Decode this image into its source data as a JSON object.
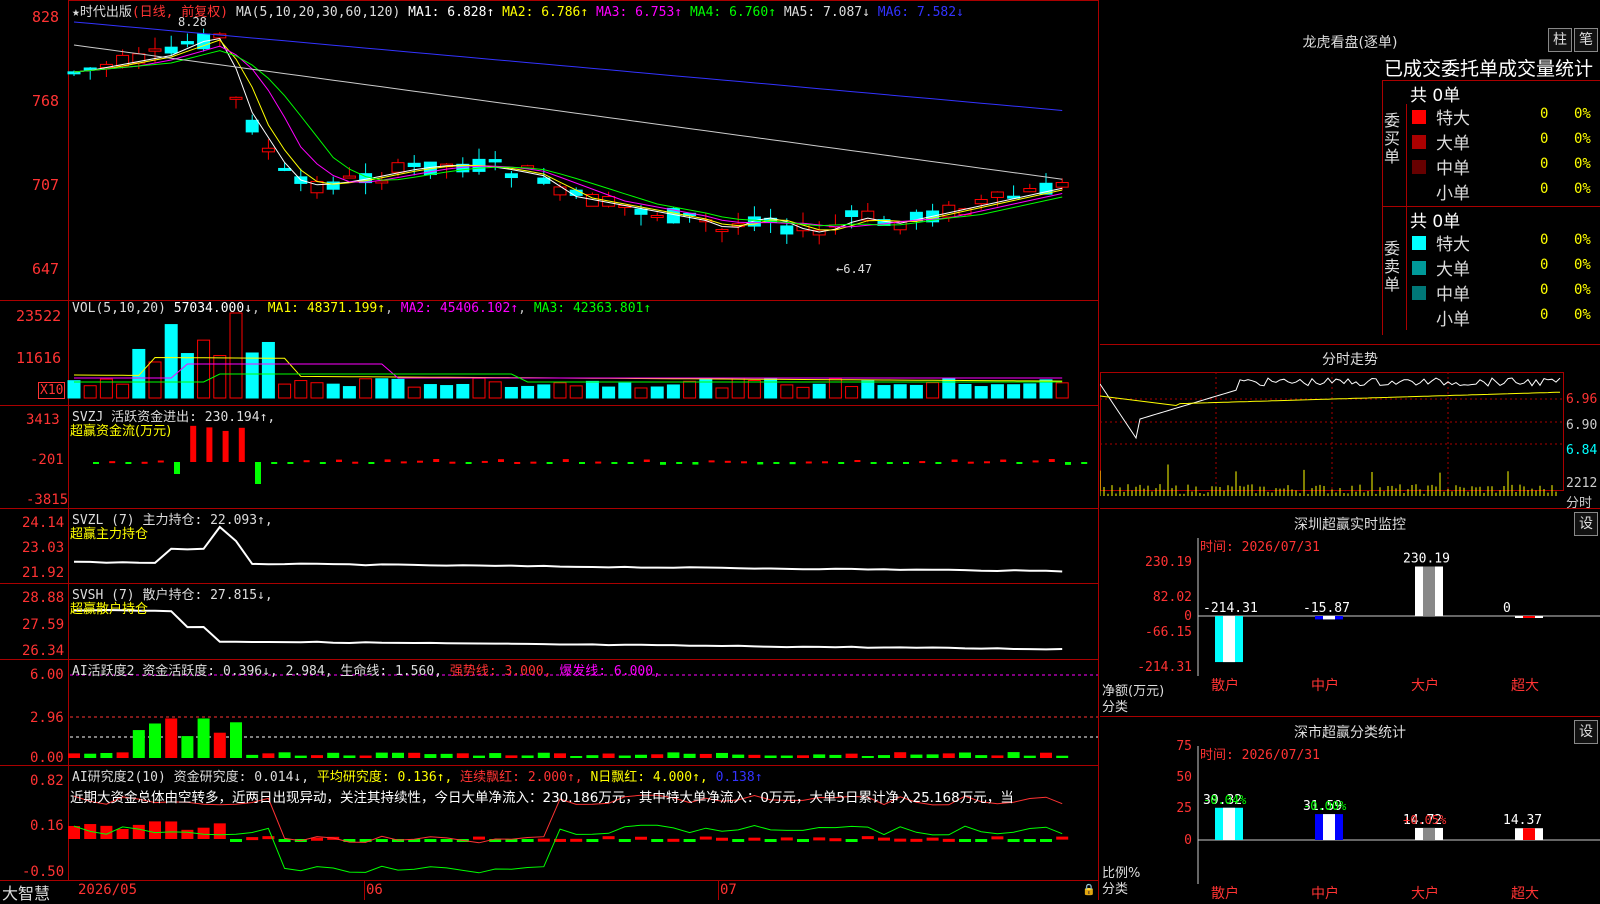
{
  "main": {
    "stock_title": "★时代出版",
    "period": "(日线, 前复权)",
    "ma_header": "MA(5,10,20,30,60,120)",
    "ma": [
      {
        "label": "MA1:",
        "value": "6.828",
        "arrow": "↑",
        "color": "#ffffff"
      },
      {
        "label": "MA2:",
        "value": "6.786",
        "arrow": "↑",
        "color": "#ffff00"
      },
      {
        "label": "MA3:",
        "value": "6.753",
        "arrow": "↑",
        "color": "#ff00ff"
      },
      {
        "label": "MA4:",
        "value": "6.760",
        "arrow": "↑",
        "color": "#00ff00"
      },
      {
        "label": "MA5:",
        "value": "7.087",
        "arrow": "↓",
        "color": "#dddddd"
      },
      {
        "label": "MA6:",
        "value": "7.582",
        "arrow": "↓",
        "color": "#3333ff"
      }
    ],
    "price_ticks": [
      "828",
      "768",
      "707",
      "647"
    ],
    "high_mark": "8.28",
    "low_mark": "←6.47",
    "x10_label": "X10"
  },
  "volume": {
    "header": "VOL(5,10,20)",
    "value": "57034.000↓",
    "ma1": "MA1: 48371.199↑",
    "ma2": "MA2: 45406.102↑",
    "ma3": "MA3: 42363.801↑",
    "ticks": [
      "23522",
      "11616"
    ]
  },
  "svzj": {
    "header": "SVZJ  活跃资金进出: 230.194↑,",
    "sub": "超赢资金流(万元)",
    "ticks": [
      "3413",
      "-201",
      "-3815"
    ]
  },
  "svzl": {
    "header": "SVZL (7) 主力持仓: 22.093↑,",
    "sub": "超赢主力持仓",
    "ticks": [
      "24.14",
      "23.03",
      "21.92"
    ]
  },
  "svsh": {
    "header": "SVSH (7) 散户持仓: 27.815↓,",
    "sub": "超赢散户持仓",
    "ticks": [
      "28.88",
      "27.59",
      "26.34"
    ]
  },
  "ai_active": {
    "header": "AI活跃度2 资金活跃度: 0.396↓, 2.984, 生命线: 1.560,",
    "strong": "强势线: 3.000,",
    "burst": "爆发线: 6.000,",
    "ticks": [
      "6.00",
      "2.96",
      "0.00"
    ]
  },
  "ai_research": {
    "header": "AI研究度2(10) 资金研究度: 0.014↓,",
    "avg": "平均研究度: 0.136↑,",
    "cont": "连续飘红: 2.000↑,",
    "nday": "N日飘红: 4.000↑,",
    "last": "0.138↑",
    "commentary": "近期大资金总体由空转多，近两日出现异动，关注其持续性，今日大单净流入：230.186万元，其中特大单净流入：0万元，大单5日累计净入25.168万元，当",
    "ticks": [
      "0.82",
      "0.16",
      "-0.50"
    ]
  },
  "bottom": {
    "brand": "大智慧",
    "months": [
      "2026/05",
      "06",
      "07"
    ]
  },
  "dragon": {
    "title": "龙虎看盘(逐单)",
    "btn1": "柱",
    "btn2": "笔",
    "subtitle": "已成交委托单成交量统计",
    "buy_label": "委买单",
    "sell_label": "委卖单",
    "buy_total": "共 0单",
    "sell_total": "共 0单",
    "buy_rows": [
      {
        "name": "特大",
        "count": "0",
        "pct": "0%",
        "color": "#ff0000"
      },
      {
        "name": "大单",
        "count": "0",
        "pct": "0%",
        "color": "#aa0000"
      },
      {
        "name": "中单",
        "count": "0",
        "pct": "0%",
        "color": "#660000"
      },
      {
        "name": "小单",
        "count": "0",
        "pct": "0%",
        "color": "#000000"
      }
    ],
    "sell_rows": [
      {
        "name": "特大",
        "count": "0",
        "pct": "0%",
        "color": "#00ffff"
      },
      {
        "name": "大单",
        "count": "0",
        "pct": "0%",
        "color": "#009999"
      },
      {
        "name": "中单",
        "count": "0",
        "pct": "0%",
        "color": "#007777"
      },
      {
        "name": "小单",
        "count": "0",
        "pct": "0%",
        "color": "#000000"
      }
    ]
  },
  "intraday": {
    "title": "分时走势",
    "ticks": [
      "6.96",
      "6.90",
      "6.84"
    ],
    "vol_tick": "2212",
    "vol_label": "分时"
  },
  "monitor": {
    "title": "深圳超赢实时监控",
    "btn": "设",
    "time": "时间: 2026/07/31",
    "ticks": [
      "230.19",
      "82.02",
      "0",
      "-66.15",
      "-214.31"
    ],
    "ylabel": "净额(万元)",
    "xlabel": "分类",
    "categories": [
      "散户",
      "中户",
      "大户",
      "超大"
    ],
    "values": [
      -214.31,
      -15.87,
      230.19,
      0
    ],
    "value_labels": [
      "-214.31",
      "-15.87",
      "230.19",
      "0"
    ]
  },
  "classify": {
    "title": "深市超赢分类统计",
    "btn": "设",
    "time": "时间: 2026/07/31",
    "ticks": [
      "75",
      "50",
      "25",
      "0"
    ],
    "ylabel": "比例%",
    "xlabel": "分类",
    "categories": [
      "散户",
      "中户",
      "大户",
      "超大"
    ],
    "values": [
      39.32,
      31.59,
      14.72,
      14.37
    ],
    "value_labels": [
      "39.32",
      "31.59",
      "14.72",
      "14.37"
    ],
    "change_labels": [
      "-0.04%",
      "-0.00%",
      "+0.05%",
      ""
    ]
  },
  "colors": {
    "up": "#ff0000",
    "down": "#00ffff",
    "frame": "#aa0000",
    "yellow": "#ffff00",
    "magenta": "#ff00ff",
    "green": "#00ff00"
  }
}
